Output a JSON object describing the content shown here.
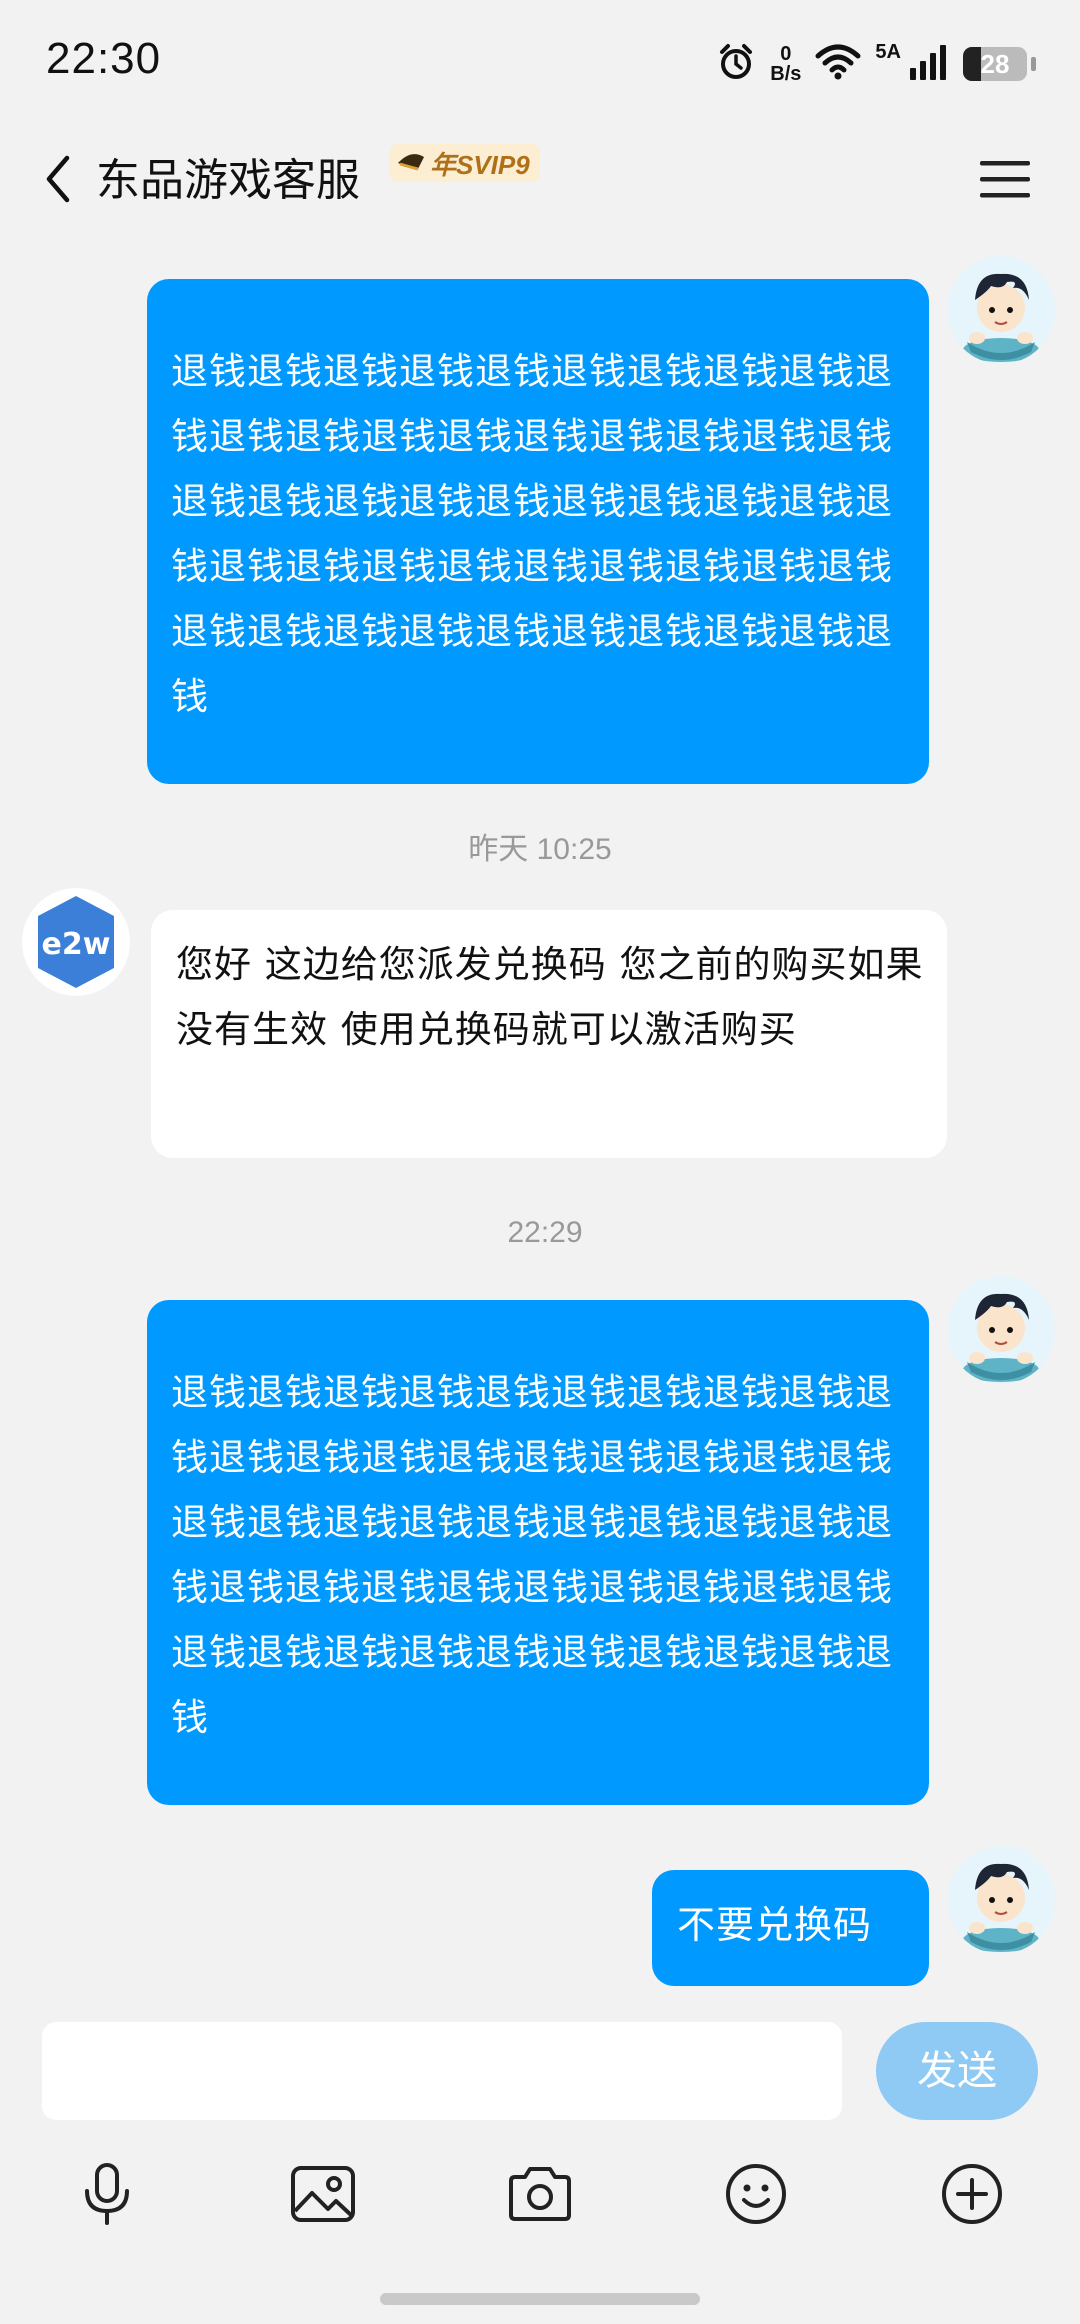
{
  "status_bar": {
    "time": "22:30",
    "net_speed_value": "0",
    "net_speed_unit": "B/s",
    "network_label": "5A",
    "battery": "28",
    "battery_level": 0.28
  },
  "header": {
    "title": "东品游戏客服",
    "vip_badge": "年SVIP9"
  },
  "messages": [
    {
      "side": "out",
      "text": "退钱退钱退钱退钱退钱退钱退钱退钱退钱退钱退钱退钱退钱退钱退钱退钱退钱退钱退钱退钱退钱退钱退钱退钱退钱退钱退钱退钱退钱退钱退钱退钱退钱退钱退钱退钱退钱退钱退钱退钱退钱退钱退钱退钱退钱退钱退钱退钱"
    },
    {
      "type": "timestamp",
      "text": "昨天 10:25"
    },
    {
      "side": "in",
      "avatar_text": "e2w",
      "text": "您好 这边给您派发兑换码 您之前的购买如果没有生效 使用兑换码就可以激活购买"
    },
    {
      "type": "timestamp",
      "text": "22:29"
    },
    {
      "side": "out",
      "text": "退钱退钱退钱退钱退钱退钱退钱退钱退钱退钱退钱退钱退钱退钱退钱退钱退钱退钱退钱退钱退钱退钱退钱退钱退钱退钱退钱退钱退钱退钱退钱退钱退钱退钱退钱退钱退钱退钱退钱退钱退钱退钱退钱退钱退钱退钱退钱退钱"
    },
    {
      "side": "out",
      "text": "不要兑换码"
    }
  ],
  "input": {
    "value": "",
    "send_label": "发送"
  },
  "toolbar": {
    "icons": [
      "microphone-icon",
      "image-icon",
      "camera-icon",
      "emoji-icon",
      "plus-icon"
    ]
  },
  "colors": {
    "outgoing_bubble": "#0099ff",
    "incoming_bubble": "#ffffff",
    "background": "#f2f2f2",
    "send_button": "#8ecaf4",
    "vip_text": "#b07018"
  }
}
